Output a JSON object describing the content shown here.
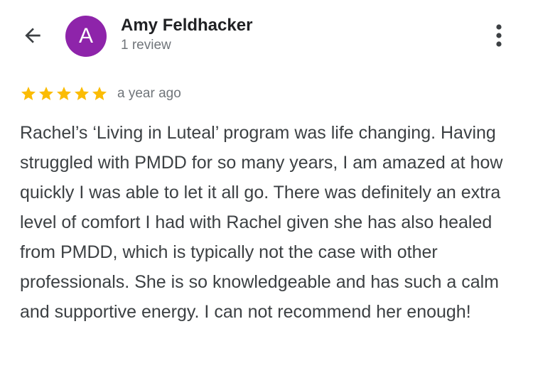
{
  "header": {
    "back_icon": "arrow-back-icon",
    "avatar_letter": "A",
    "avatar_color": "#8e24aa",
    "reviewer_name": "Amy Feldhacker",
    "review_count": "1 review",
    "more_icon": "more-vertical-icon"
  },
  "review": {
    "rating": 5,
    "rating_max": 5,
    "star_color": "#fbbc04",
    "date": "a year ago",
    "text": "Rachel’s ‘Living in Luteal’ program was life changing. Having struggled with PMDD for so many years, I am amazed at how quickly I was able to let it all go. There was definitely an extra level of comfort I had with Rachel given she has also healed from PMDD, which is typically not the case with other professionals. She is so knowledgeable and has such a calm and supportive energy. I can not recommend her enough!"
  }
}
